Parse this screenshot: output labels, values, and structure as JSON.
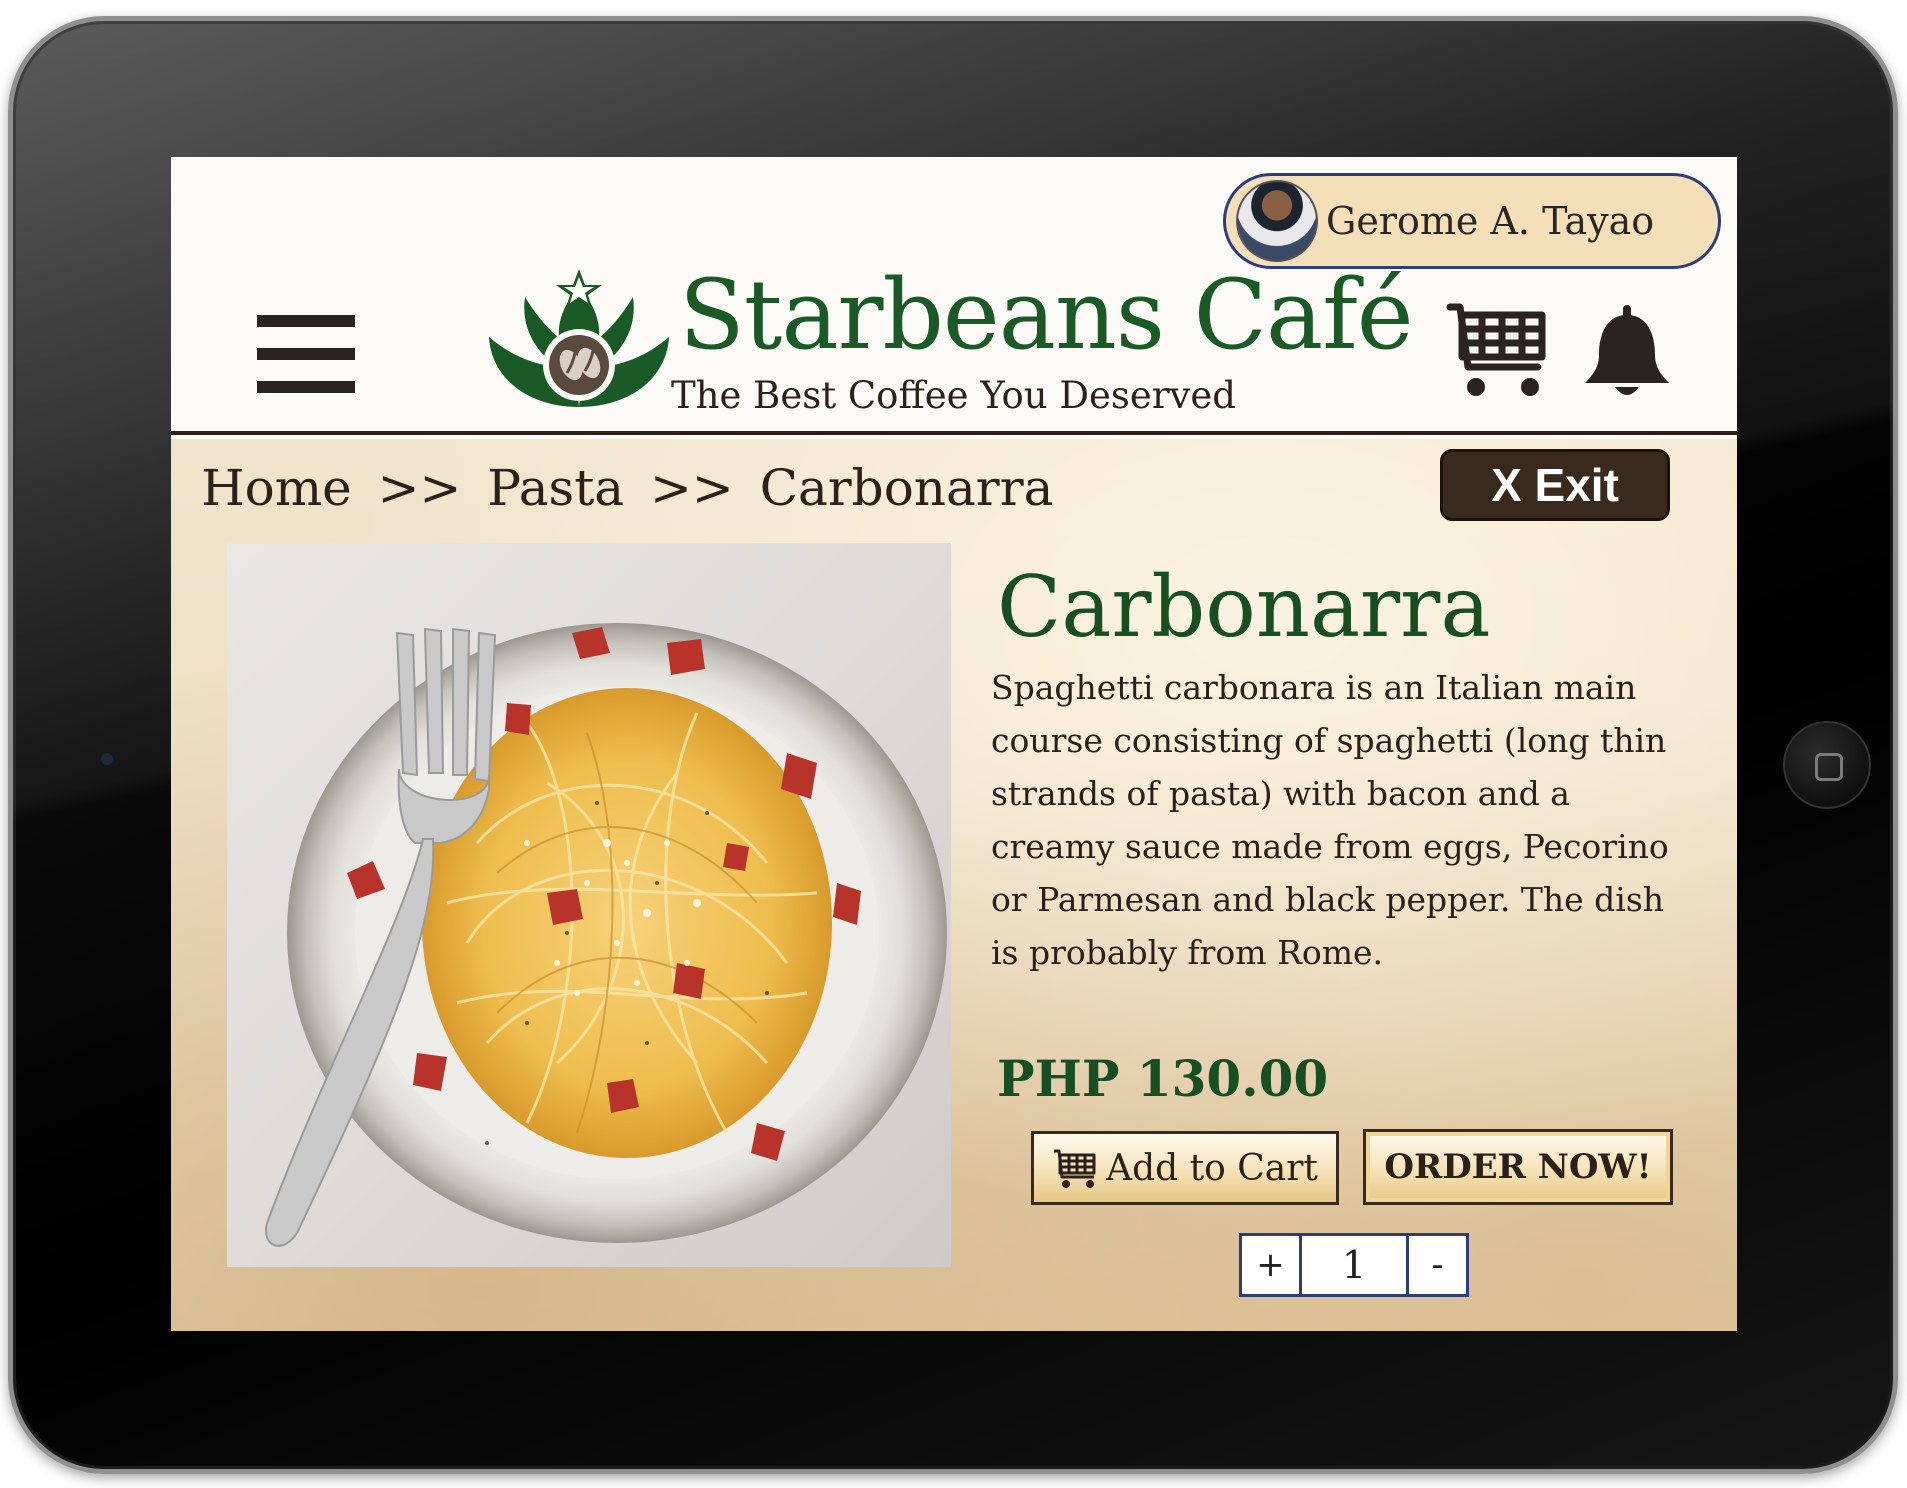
{
  "header": {
    "user_name": "Gerome A. Tayao",
    "brand_name": "Starbeans Café",
    "tagline": "The Best Coffee You Deserved",
    "brand_color": "#195a27"
  },
  "icons": {
    "menu": "hamburger-menu-icon",
    "cart": "shopping-cart-icon",
    "notifications": "bell-icon",
    "user": "avatar"
  },
  "breadcrumb": {
    "items": [
      "Home",
      "Pasta",
      "Carbonarra"
    ],
    "separator": ">>"
  },
  "exit_label": "X Exit",
  "product": {
    "name": "Carbonarra",
    "description": "Spaghetti carbonara is an Italian main course consisting of spaghetti (long thin strands of pasta) with bacon and a creamy sauce made from eggs, Pecorino or Parmesan and black pepper. The dish is probably from Rome.",
    "price": "PHP 130.00",
    "image": "carbonara-plate-photo"
  },
  "actions": {
    "add_to_cart": "Add to Cart",
    "order_now": "ORDER NOW!"
  },
  "quantity": {
    "plus": "+",
    "value": "1",
    "minus": "-"
  },
  "colors": {
    "accent_green": "#184f22",
    "dark_brown": "#3a2a1e",
    "stepper_border": "#2e3d7a"
  }
}
